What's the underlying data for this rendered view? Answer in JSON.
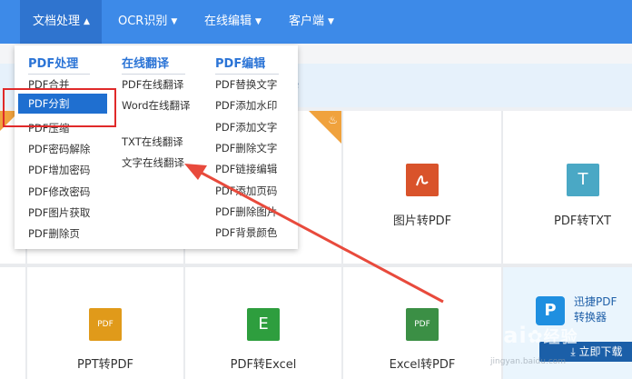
{
  "nav": {
    "items": [
      {
        "label": "文档处理",
        "caret": "▲"
      },
      {
        "label": "OCR识别",
        "caret": "▼"
      },
      {
        "label": "在线编辑",
        "caret": "▼"
      },
      {
        "label": "客户端",
        "caret": "▼"
      }
    ],
    "color": "#3d8ae8"
  },
  "notice_glyph": "e",
  "dropdown": {
    "pdf_process": {
      "title": "PDF处理",
      "items": [
        "PDF合并",
        "PDF分割",
        "PDF压缩",
        "PDF密码解除",
        "PDF增加密码",
        "PDF修改密码",
        "PDF图片获取",
        "PDF删除页"
      ],
      "selected": "PDF分割"
    },
    "translate": {
      "title": "在线翻译",
      "items": [
        "PDF在线翻译",
        "Word在线翻译",
        "TXT在线翻译",
        "文字在线翻译"
      ]
    },
    "pdf_edit": {
      "title": "PDF编辑",
      "items": [
        "PDF替换文字",
        "PDF添加水印",
        "PDF添加文字",
        "PDF删除文字",
        "PDF链接编辑",
        "PDF添加页码",
        "PDF删除图片",
        "PDF背景颜色"
      ]
    }
  },
  "tiles": {
    "row1": [
      {
        "label": "图片转PDF",
        "icon": "pdf-icon",
        "color": "#d9532b"
      },
      {
        "label": "PDF转TXT",
        "icon": "txt-icon",
        "glyph": "T",
        "color": "#4aa8c5"
      }
    ],
    "row2": [
      {
        "label": "PPT转PDF",
        "icon": "ppt-icon",
        "glyph": "PDF",
        "color": "#e09a1a"
      },
      {
        "label": "PDF转Excel",
        "icon": "excel-icon",
        "glyph": "E",
        "color": "#2e9e3e"
      },
      {
        "label": "Excel转PDF",
        "icon": "pdf-doc-icon",
        "glyph": "PDF",
        "color": "#3b8f45"
      }
    ],
    "hot_color": "#f0a23d"
  },
  "promo": {
    "logo_glyph": "P",
    "title_line1": "迅捷PDF",
    "title_line2": "转换器",
    "download_label": "立即下载"
  },
  "watermark": {
    "text": "Bai",
    "text2": "经验",
    "sub": "jingyan.baidu.com"
  },
  "annotation": {
    "box_color": "#e02a2a",
    "arrow_color": "#e84a3c"
  }
}
